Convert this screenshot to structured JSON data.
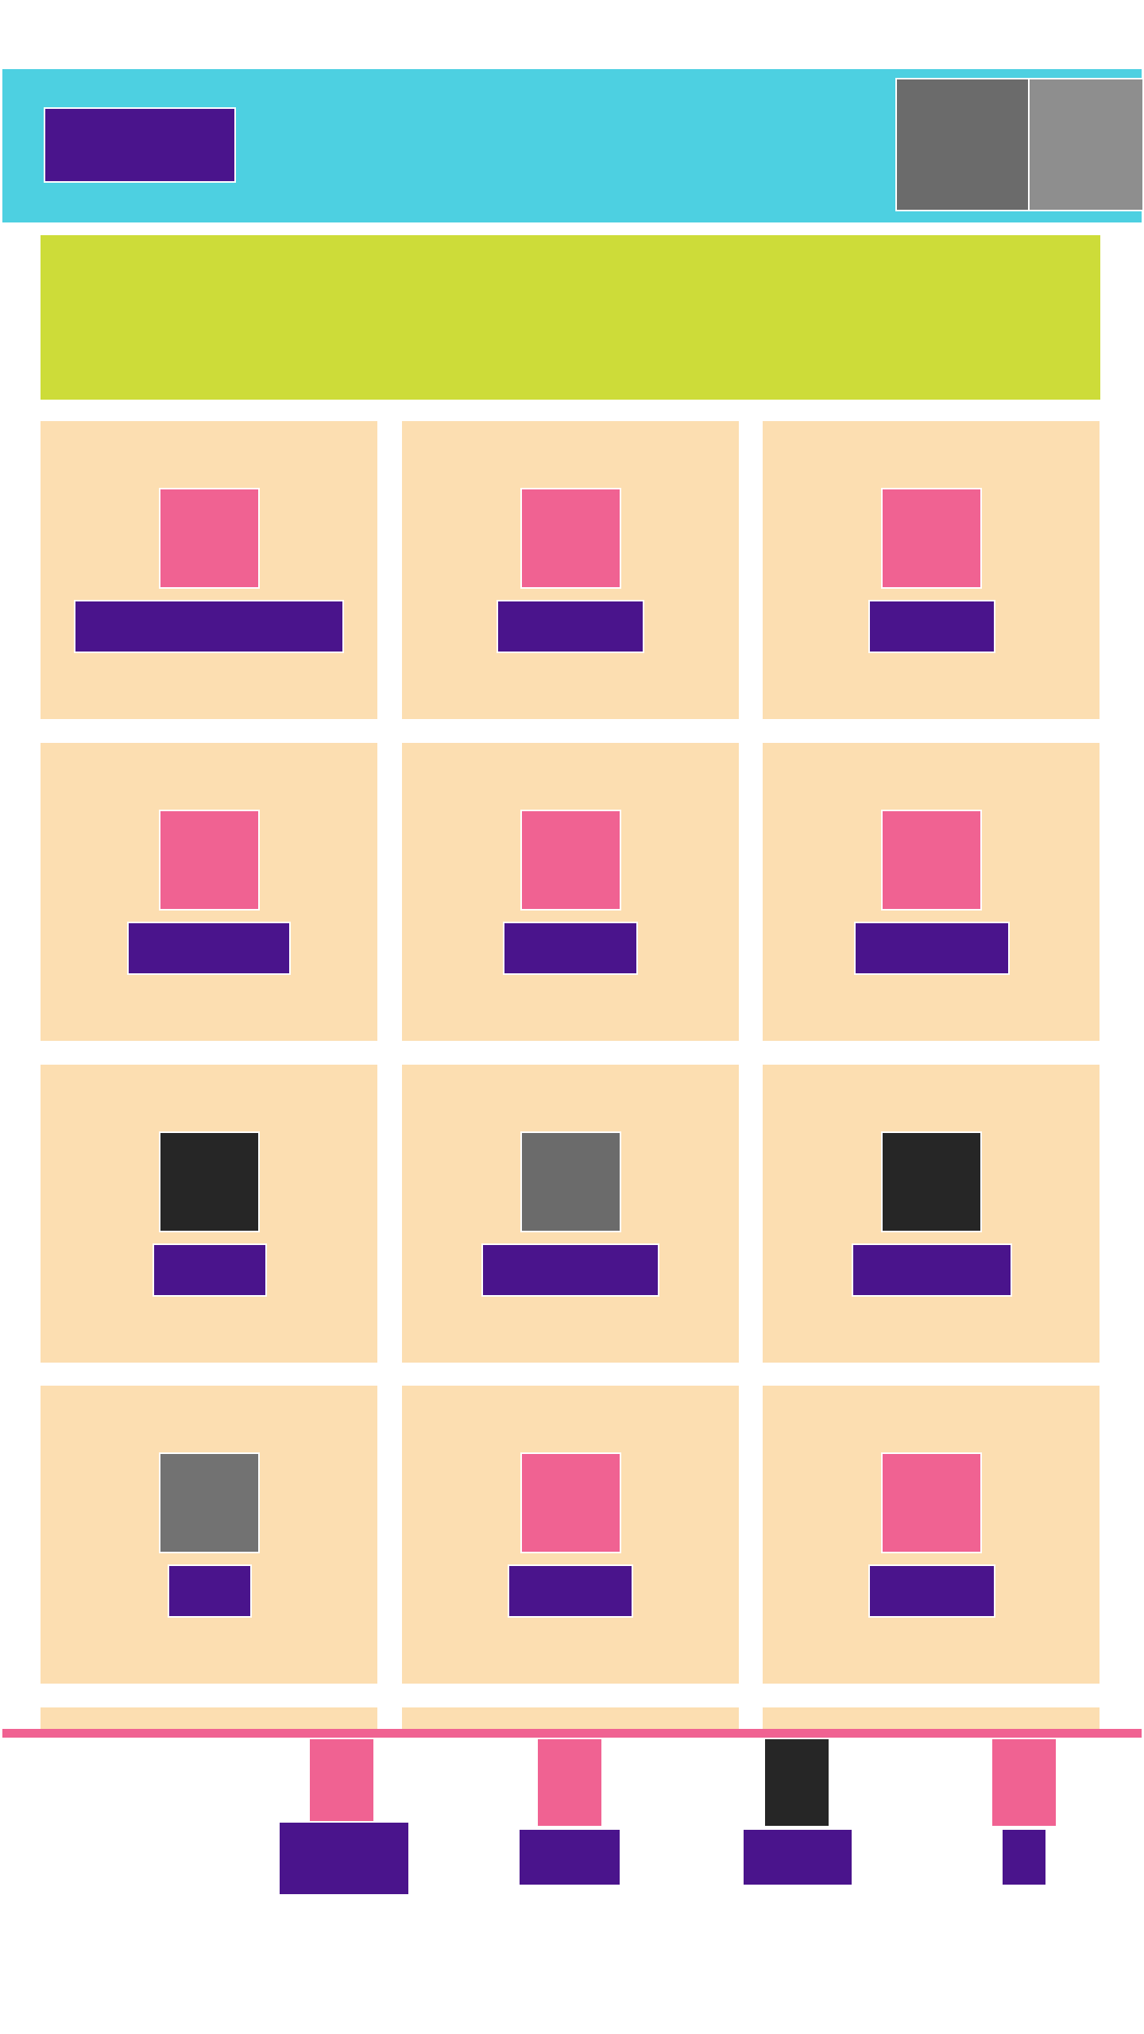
{
  "colors": {
    "header_bg": "#4dd0e1",
    "accent": "#4a148c",
    "banner_bg": "#cddc39",
    "card_bg": "#fcdeb1",
    "thumb_pink": "#f06292",
    "thumb_dark": "#262626",
    "thumb_gray": "#6b6b6b",
    "nav_divider": "#f06292"
  },
  "header": {
    "logo": "",
    "actions": [
      {
        "name": "header-action-1",
        "color": "#6b6b6b"
      },
      {
        "name": "header-action-2",
        "color": "#8e8e8e"
      }
    ]
  },
  "banner": {
    "text": ""
  },
  "grid": {
    "cards": [
      {
        "thumb_color": "#f06292",
        "label": ""
      },
      {
        "thumb_color": "#f06292",
        "label": ""
      },
      {
        "thumb_color": "#f06292",
        "label": ""
      },
      {
        "thumb_color": "#f06292",
        "label": ""
      },
      {
        "thumb_color": "#f06292",
        "label": ""
      },
      {
        "thumb_color": "#f06292",
        "label": ""
      },
      {
        "thumb_color": "#262626",
        "label": ""
      },
      {
        "thumb_color": "#6b6b6b",
        "label": ""
      },
      {
        "thumb_color": "#262626",
        "label": ""
      },
      {
        "thumb_color": "#727272",
        "label": ""
      },
      {
        "thumb_color": "#f06292",
        "label": ""
      },
      {
        "thumb_color": "#f06292",
        "label": ""
      }
    ]
  },
  "bottom_nav": {
    "items": [
      {
        "icon_color": "#f06292",
        "label": ""
      },
      {
        "icon_color": "#f06292",
        "label": ""
      },
      {
        "icon_color": "#262626",
        "label": ""
      },
      {
        "icon_color": "#f06292",
        "label": ""
      }
    ]
  }
}
